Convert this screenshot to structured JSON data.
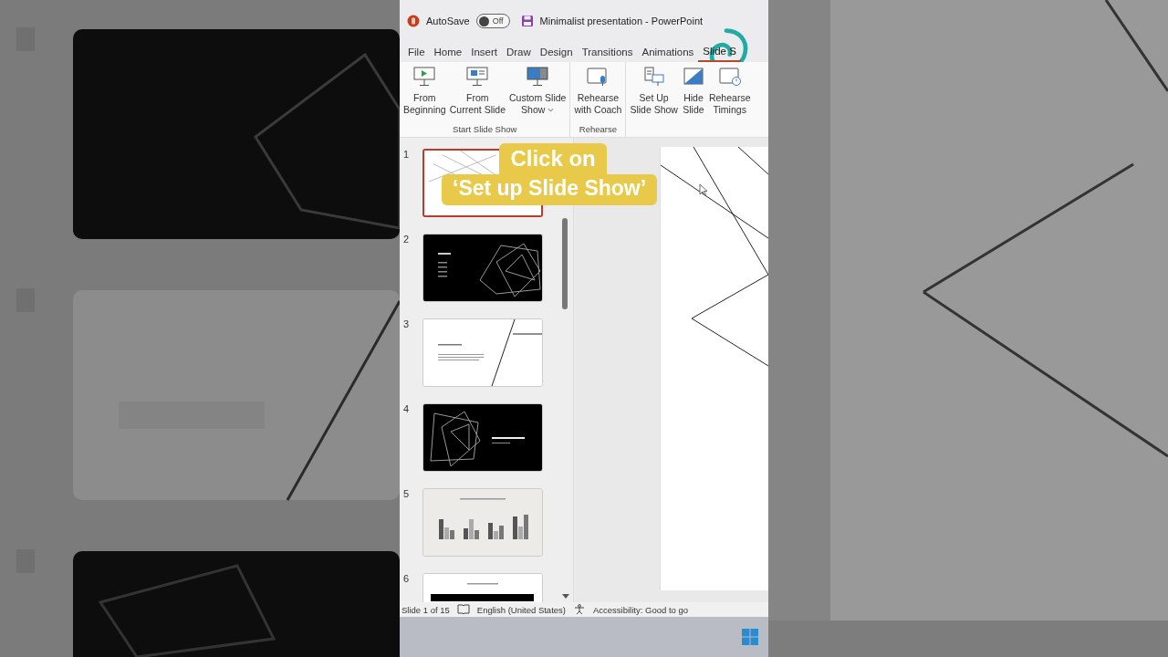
{
  "window": {
    "title": "Minimalist presentation  -  PowerPoint",
    "autosave": {
      "label": "AutoSave",
      "on": false,
      "state_text": "Off"
    }
  },
  "tabs": [
    {
      "label": "File",
      "selected": false
    },
    {
      "label": "Home",
      "selected": false
    },
    {
      "label": "Insert",
      "selected": false
    },
    {
      "label": "Draw",
      "selected": false
    },
    {
      "label": "Design",
      "selected": false
    },
    {
      "label": "Transitions",
      "selected": false
    },
    {
      "label": "Animations",
      "selected": false
    },
    {
      "label": "Slide S",
      "selected": true
    }
  ],
  "ribbon": {
    "groups": [
      {
        "label": "Start Slide Show",
        "buttons": [
          {
            "kind": "beginning",
            "lines": [
              "From",
              "Beginning"
            ],
            "dropdown": false
          },
          {
            "kind": "current",
            "lines": [
              "From",
              "Current Slide"
            ],
            "dropdown": false
          },
          {
            "kind": "custom",
            "lines": [
              "Custom Slide",
              "Show"
            ],
            "dropdown": true
          }
        ]
      },
      {
        "label": "Rehearse",
        "buttons": [
          {
            "kind": "coach",
            "lines": [
              "Rehearse",
              "with Coach"
            ],
            "dropdown": false
          }
        ]
      },
      {
        "buttons": [
          {
            "kind": "setup",
            "lines": [
              "Set Up",
              "Slide Show"
            ],
            "dropdown": false
          },
          {
            "kind": "hide",
            "lines": [
              "Hide",
              "Slide"
            ],
            "dropdown": false
          },
          {
            "kind": "timings",
            "lines": [
              "Rehearse",
              "Timings"
            ],
            "dropdown": false
          }
        ]
      }
    ]
  },
  "slides": [
    {
      "number": "1",
      "kind": "lines",
      "selected": true
    },
    {
      "number": "2",
      "kind": "dark",
      "selected": false
    },
    {
      "number": "3",
      "kind": "intro",
      "selected": false
    },
    {
      "number": "4",
      "kind": "goals",
      "selected": false
    },
    {
      "number": "5",
      "kind": "chart",
      "selected": false
    },
    {
      "number": "6",
      "kind": "table",
      "selected": false
    }
  ],
  "caption": {
    "lines": [
      "Click on",
      "‘Set up Slide Show’"
    ]
  },
  "status_bar": {
    "slide": "Slide 1 of 15",
    "language": "English (United States)",
    "accessibility": "Accessibility: Good to go"
  }
}
